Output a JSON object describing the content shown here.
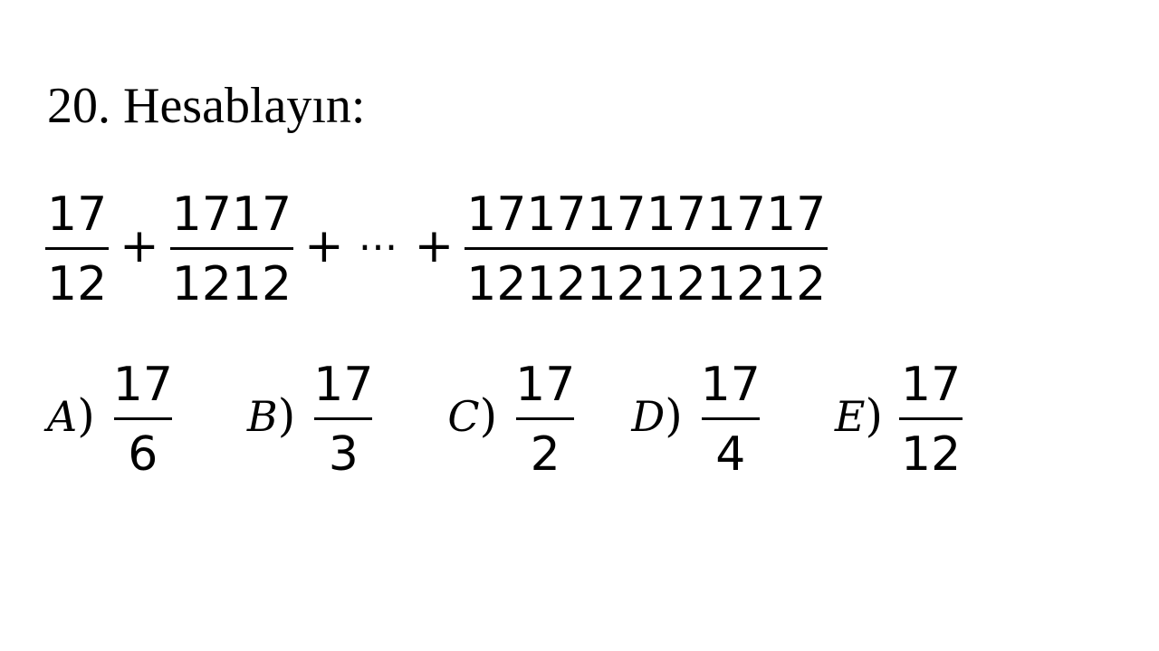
{
  "question": {
    "title": "20. Hesablayın:"
  },
  "expression": {
    "term1": {
      "num": "17",
      "den": "12"
    },
    "term2": {
      "num": "1717",
      "den": "1212"
    },
    "term3": {
      "num": "171717171717",
      "den": "121212121212"
    },
    "plus": "+",
    "ellipsis": "⋯"
  },
  "answers": [
    {
      "letter": "A",
      "paren": ")",
      "num": "17",
      "den": "6"
    },
    {
      "letter": "B",
      "paren": ")",
      "num": "17",
      "den": "3"
    },
    {
      "letter": "C",
      "paren": ")",
      "num": "17",
      "den": "2"
    },
    {
      "letter": "D",
      "paren": ")",
      "num": "17",
      "den": "4"
    },
    {
      "letter": "E",
      "paren": ")",
      "num": "17",
      "den": "12"
    }
  ]
}
